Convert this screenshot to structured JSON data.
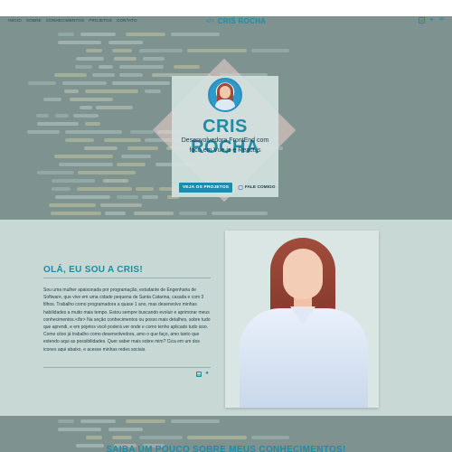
{
  "nav": {
    "links": [
      "INÍCIO",
      "SOBRE",
      "CONHECIMENTOS",
      "PROJETOS",
      "CONTATO"
    ],
    "brand": "CRIS ROCHA",
    "brand_icon": "code-bracket-icon",
    "social": [
      "linkedin-icon",
      "github-icon",
      "email-icon"
    ]
  },
  "hero": {
    "name": "CRIS ROCHA",
    "role": "Desenvolvedora FrontEnd com foco em Vue.js e React.js",
    "btn_projects": "VEJA OS PROJETOS",
    "btn_contact": "FALE COMIGO",
    "btn_contact_icon": "chat-icon"
  },
  "about": {
    "title": "OLÁ, EU SOU A CRIS!",
    "text": "Sou uma mulher apaixonada por programação, estudante de Engenharia de Software, que vive em uma cidade pequena de Santa Catarina, casada e com 3 filhos. Trabalho como programadora a quase 1 ano, mas desenvolvo minhas habilidades a muito mais tempo. Estou sempre buscando evoluir e aprimorar meus conhecimentos.</br> Na seção conhecimentos ou posso mais detalhes, sobre tudo que aprendi, e em pojetos você poderá ver onde e como tenho aplicado tudo isso. Como citoo já trabalho como desenvolvedora, amo o que faço, amo tanto que estendo aqui as possibilidades. Quer saber mais sobre mim? Cica em um dos icones aqui abaixo, e acesse minhas redes sociais.",
    "social": [
      "linkedin-icon",
      "github-icon"
    ]
  },
  "skills": {
    "title": "SAIBA UM POUCO SOBRE MEUS CONHECIMENTOS!"
  },
  "colors": {
    "accent": "#1f8ca7",
    "dark_bg": "#5f6f6c",
    "about_bg": "#c8d8d4"
  }
}
